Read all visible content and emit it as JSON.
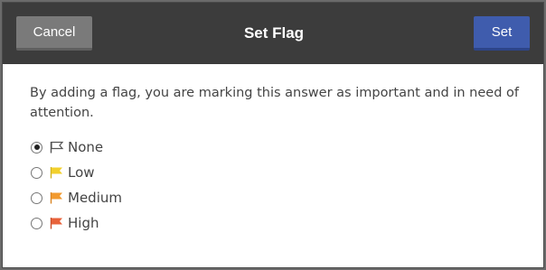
{
  "header": {
    "title": "Set Flag",
    "cancel_label": "Cancel",
    "set_label": "Set"
  },
  "body": {
    "description": "By adding a flag, you are marking this answer as important and in need of attention."
  },
  "options": [
    {
      "label": "None",
      "selected": true,
      "flag_color": "none",
      "icon": "flag-outline-icon"
    },
    {
      "label": "Low",
      "selected": false,
      "flag_color": "#f2d02c",
      "icon": "flag-yellow-icon"
    },
    {
      "label": "Medium",
      "selected": false,
      "flag_color": "#f29a2e",
      "icon": "flag-orange-icon"
    },
    {
      "label": "High",
      "selected": false,
      "flag_color": "#e8623a",
      "icon": "flag-red-icon"
    }
  ],
  "colors": {
    "header_bg": "#3c3c3c",
    "cancel_bg": "#7a7a7a",
    "set_bg": "#3f5cad"
  }
}
